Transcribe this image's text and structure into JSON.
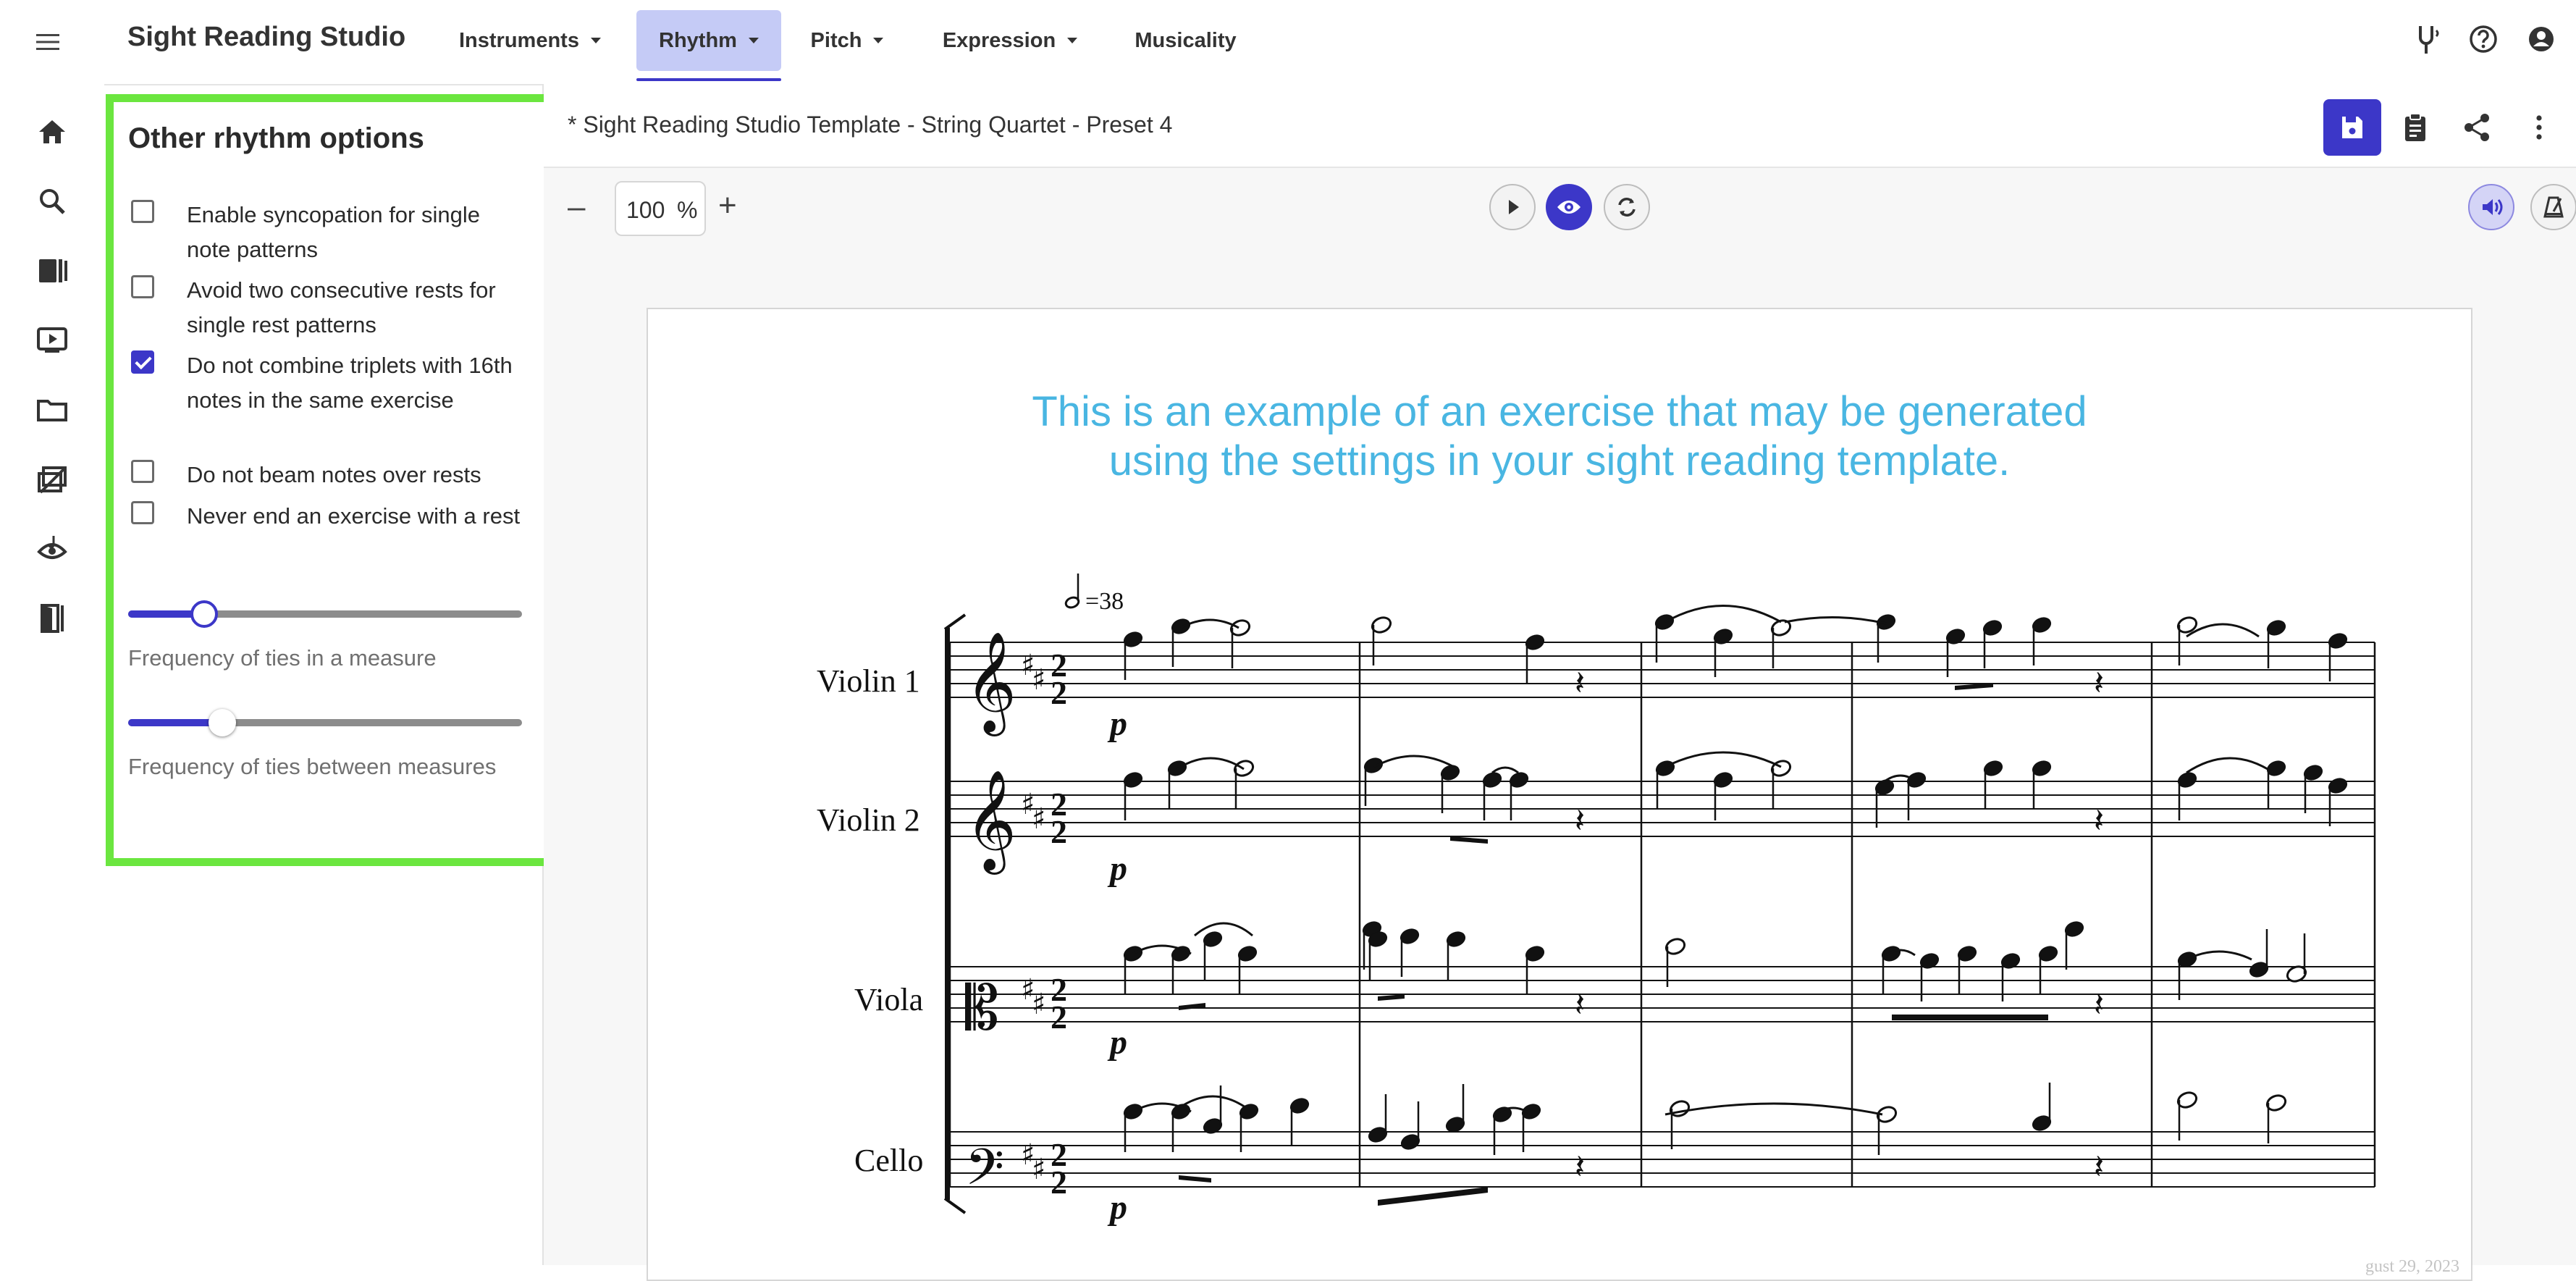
{
  "app": {
    "title": "Sight Reading Studio"
  },
  "nav": {
    "items": [
      {
        "label": "Instruments",
        "has_menu": true,
        "active": false
      },
      {
        "label": "Rhythm",
        "has_menu": true,
        "active": true
      },
      {
        "label": "Pitch",
        "has_menu": true,
        "active": false
      },
      {
        "label": "Expression",
        "has_menu": true,
        "active": false
      },
      {
        "label": "Musicality",
        "has_menu": false,
        "active": false
      }
    ]
  },
  "top_icons": [
    "tuning-fork-icon",
    "help-icon",
    "account-icon"
  ],
  "rail_icons": [
    "home-icon",
    "search-icon",
    "library-icon",
    "video-icon",
    "folder-icon",
    "template-icon",
    "ear-icon",
    "exit-icon"
  ],
  "panel": {
    "title": "Other rhythm options",
    "options": [
      {
        "label": "Enable syncopation for single note patterns",
        "checked": false
      },
      {
        "label": "Avoid two consecutive rests for single rest patterns",
        "checked": false
      },
      {
        "label": "Do not combine triplets with 16th notes in the same exercise",
        "checked": true
      },
      {
        "label": "Do not beam notes over rests",
        "checked": false
      },
      {
        "label": "Never end an exercise with a rest",
        "checked": false
      }
    ],
    "sliders": [
      {
        "label": "Frequency of ties in a measure",
        "value": 0.17
      },
      {
        "label": "Frequency of ties between measures",
        "value": 0.22
      }
    ]
  },
  "document": {
    "title": "* Sight Reading Studio Template - String Quartet - Preset 4",
    "actions": [
      "save-icon",
      "clipboard-icon",
      "share-icon",
      "more-vert-icon"
    ]
  },
  "toolbar": {
    "zoom_out": "–",
    "zoom_value": "100",
    "zoom_unit": "%",
    "zoom_in": "+"
  },
  "score": {
    "caption_line1": "This is an example of an exercise that may be generated",
    "caption_line2": "using the settings in your sight reading template.",
    "tempo_value": "=38",
    "time_signature": {
      "numerator": "2",
      "denominator": "2"
    },
    "dynamic": "p",
    "instruments": [
      "Violin 1",
      "Violin 2",
      "Viola",
      "Cello"
    ],
    "watermark": "gust 29, 2023"
  },
  "colors": {
    "accent": "#3c37c8",
    "highlight": "#6be63f",
    "caption": "#49b6e2"
  }
}
